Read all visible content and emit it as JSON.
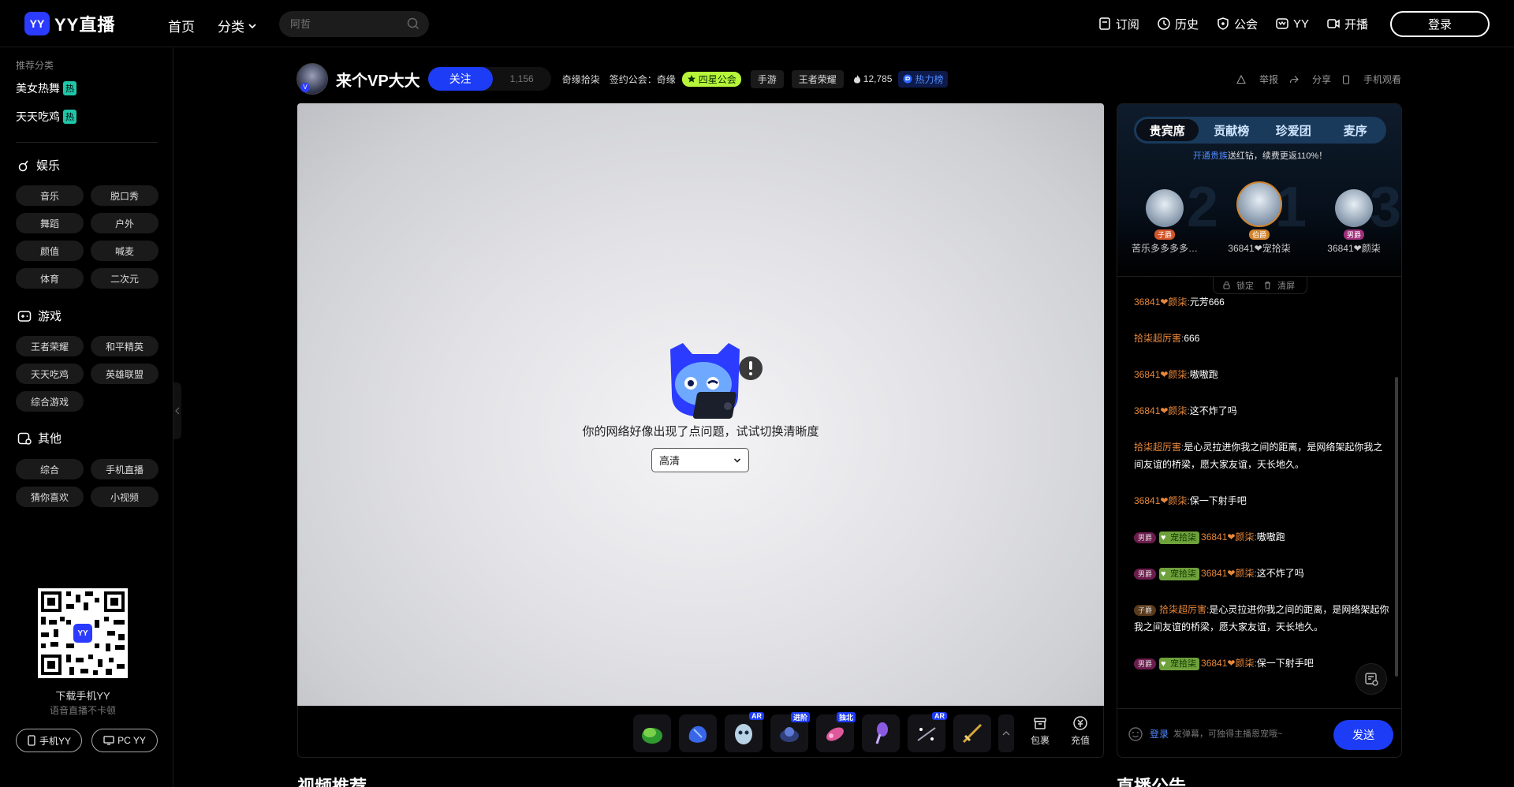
{
  "brand": {
    "logo_badge": "YY",
    "logo_text": "YY直播",
    "accent": "#1d3cf5"
  },
  "nav": {
    "home": "首页",
    "category": "分类"
  },
  "search": {
    "placeholder": "阿哲"
  },
  "top_right": {
    "subscribe": "订阅",
    "history": "历史",
    "guild": "公会",
    "yy": "YY",
    "broadcast": "开播",
    "login": "登录"
  },
  "sidebar": {
    "recommend_title": "推荐分类",
    "hot_items": [
      {
        "label": "美女热舞",
        "tag": "热"
      },
      {
        "label": "天天吃鸡",
        "tag": "热"
      }
    ],
    "groups": [
      {
        "title": "娱乐",
        "items": [
          "音乐",
          "脱口秀",
          "舞蹈",
          "户外",
          "颜值",
          "喊麦",
          "体育",
          "二次元"
        ]
      },
      {
        "title": "游戏",
        "items": [
          "王者荣耀",
          "和平精英",
          "天天吃鸡",
          "英雄联盟",
          "综合游戏"
        ]
      },
      {
        "title": "其他",
        "items": [
          "综合",
          "手机直播",
          "猜你喜欢",
          "小视频"
        ]
      }
    ],
    "qr_badge": "YY",
    "qr_title": "下载手机YY",
    "qr_sub": "语音直播不卡顿",
    "app_mobile": "手机YY",
    "app_pc": "PC YY"
  },
  "room": {
    "host": "来个VP大大",
    "follow": "关注",
    "follow_count": "1,156",
    "channel": "奇缘拾柒",
    "guild_label": "签约公会：奇缘",
    "guild_tag": "四星公会",
    "category_tag": "手游",
    "game_tag": "王者荣耀",
    "hot": "12,785",
    "rank": "热力榜",
    "actions": {
      "report": "举报",
      "share": "分享",
      "mobile_watch": "手机观看"
    }
  },
  "player": {
    "error": "你的网络好像出现了点问题，试试切换清晰度",
    "quality": "高清"
  },
  "gifts": {
    "tags": [
      "",
      "",
      "AR",
      "进阶",
      "独北",
      "",
      "AR",
      ""
    ],
    "package": "包裹",
    "recharge": "充值"
  },
  "panel": {
    "tabs": [
      "贵宾席",
      "贡献榜",
      "珍爱团",
      "麦序"
    ],
    "promo_link": "开通贵族",
    "promo_text": "送红钻，续费更返110%！",
    "seats": [
      {
        "name": "苦乐多多多多…",
        "rank": "子爵",
        "rank_color": "#d2552b",
        "bg": "2"
      },
      {
        "name": "36841❤宠拾柒",
        "rank": "伯爵",
        "rank_color": "#d2832b",
        "bg": "1"
      },
      {
        "name": "36841❤颜柒",
        "rank": "男爵",
        "rank_color": "#a0307a",
        "bg": "3"
      }
    ],
    "lock": "锁定",
    "clear": "清屏",
    "messages": [
      {
        "user": "36841❤颜柒",
        "text": "元芳666"
      },
      {
        "user": "拾柒超厉害",
        "text": "666"
      },
      {
        "user": "36841❤颜柒",
        "text": "嗷嗷跑"
      },
      {
        "user": "36841❤颜柒",
        "text": "这不炸了吗"
      },
      {
        "user": "拾柒超厉害",
        "text": "是心灵拉进你我之间的距离，是网络架起你我之间友谊的桥梁，愿大家友谊，天长地久。"
      },
      {
        "user": "36841❤颜柒",
        "text": "保一下射手吧"
      },
      {
        "lvl": "男爵",
        "fan": "宠拾柒",
        "user": "36841❤颜柒",
        "text": "嗷嗷跑"
      },
      {
        "lvl": "男爵",
        "fan": "宠拾柒",
        "user": "36841❤颜柒",
        "text": "这不炸了吗"
      },
      {
        "lvl": "子爵",
        "user": "拾柒超厉害",
        "text": "是心灵拉进你我之间的距离，是网络架起你我之间友谊的桥梁，愿大家友谊，天长地久。"
      },
      {
        "lvl": "男爵",
        "fan": "宠拾柒",
        "user": "36841❤颜柒",
        "text": "保一下射手吧"
      }
    ],
    "input_login": "登录",
    "input_placeholder": "发弹幕，可独得主播恩宠哦~",
    "send": "发送"
  },
  "bottom": {
    "left_title": "视频推荐",
    "right_title": "直播公告"
  }
}
